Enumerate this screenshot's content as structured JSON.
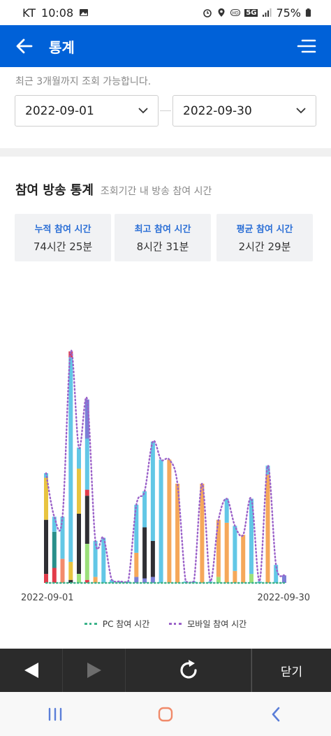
{
  "status_bar": {
    "carrier": "KT",
    "time": "10:08",
    "battery": "75%",
    "network": "5G"
  },
  "header": {
    "title": "통계"
  },
  "filter": {
    "notice": "최근 3개월까지 조회 가능합니다.",
    "date_from": "2022-09-01",
    "date_to": "2022-09-30"
  },
  "summary": {
    "title": "참여 방송 통계",
    "subtitle": "조회기간 내 방송 참여 시간",
    "cards": [
      {
        "label": "누적 참여 시간",
        "value": "74시간 25분"
      },
      {
        "label": "최고 참여 시간",
        "value": "8시간 31분"
      },
      {
        "label": "평균 참여 시간",
        "value": "2시간 29분"
      }
    ]
  },
  "colors": {
    "accent": "#0061d8",
    "pc_line": "#3bb38a",
    "mobile_line": "#9b62c9"
  },
  "chart_data": {
    "type": "bar",
    "x_start_label": "2022-09-01",
    "x_end_label": "2022-09-30",
    "days": 30,
    "ymax": 8.6,
    "segment_colors": [
      "#e23b4a",
      "#2f2f34",
      "#e8c440",
      "#2a8f8a",
      "#f38b6b",
      "#9be07a",
      "#f5a85a",
      "#62c7e6",
      "#7b7fd6"
    ],
    "bars": [
      [
        [
          0,
          0.3
        ],
        [
          1,
          1.8
        ],
        [
          2,
          1.4
        ],
        [
          7,
          0.15
        ]
      ],
      [
        [
          0,
          0.5
        ],
        [
          3,
          1.2
        ],
        [
          7,
          0.5
        ]
      ],
      [
        [
          4,
          0.8
        ],
        [
          7,
          1.4
        ]
      ],
      [
        [
          1,
          0.1
        ],
        [
          2,
          0.6
        ],
        [
          7,
          6.8
        ],
        [
          0,
          0.2
        ]
      ],
      [
        [
          5,
          0.3
        ],
        [
          1,
          2.0
        ],
        [
          2,
          1.5
        ],
        [
          7,
          0.7
        ]
      ],
      [
        [
          0,
          0.1
        ],
        [
          5,
          1.2
        ],
        [
          1,
          1.6
        ],
        [
          0,
          0.2
        ],
        [
          7,
          1.7
        ],
        [
          8,
          1.3
        ]
      ],
      [
        [
          6,
          0.2
        ],
        [
          7,
          1.2
        ]
      ],
      [
        [
          7,
          1.5
        ]
      ],
      [
        [
          7,
          0.1
        ]
      ],
      [
        [
          7,
          0.05
        ]
      ],
      [
        [
          7,
          0.05
        ]
      ],
      [
        [
          8,
          0.2
        ],
        [
          6,
          0.8
        ],
        [
          7,
          1.6
        ]
      ],
      [
        [
          8,
          0.15
        ],
        [
          1,
          1.7
        ],
        [
          7,
          1.2
        ]
      ],
      [
        [
          8,
          0.2
        ],
        [
          1,
          1.2
        ],
        [
          7,
          3.3
        ]
      ],
      [
        [
          7,
          4.1
        ]
      ],
      [
        [
          6,
          4.1
        ]
      ],
      [
        [
          6,
          3.3
        ]
      ],
      [
        [
          7,
          0.05
        ]
      ],
      [
        [
          7,
          0.05
        ]
      ],
      [
        [
          6,
          3.3
        ]
      ],
      [
        [
          7,
          0.05
        ]
      ],
      [
        [
          5,
          0.2
        ],
        [
          6,
          1.9
        ]
      ],
      [
        [
          6,
          2.0
        ],
        [
          7,
          0.8
        ]
      ],
      [
        [
          6,
          0.4
        ],
        [
          7,
          1.5
        ]
      ],
      [
        [
          6,
          1.6
        ]
      ],
      [
        [
          5,
          0.3
        ],
        [
          7,
          2.5
        ]
      ],
      [
        [
          7,
          0.05
        ]
      ],
      [
        [
          6,
          3.6
        ],
        [
          7,
          0.3
        ]
      ],
      [
        [
          7,
          0.6
        ]
      ],
      [
        [
          8,
          0.25
        ]
      ]
    ]
  },
  "legend": {
    "pc": "PC 참여 시간",
    "mobile": "모바일 참여 시간"
  },
  "bottom_nav": {
    "close_label": "닫기"
  }
}
